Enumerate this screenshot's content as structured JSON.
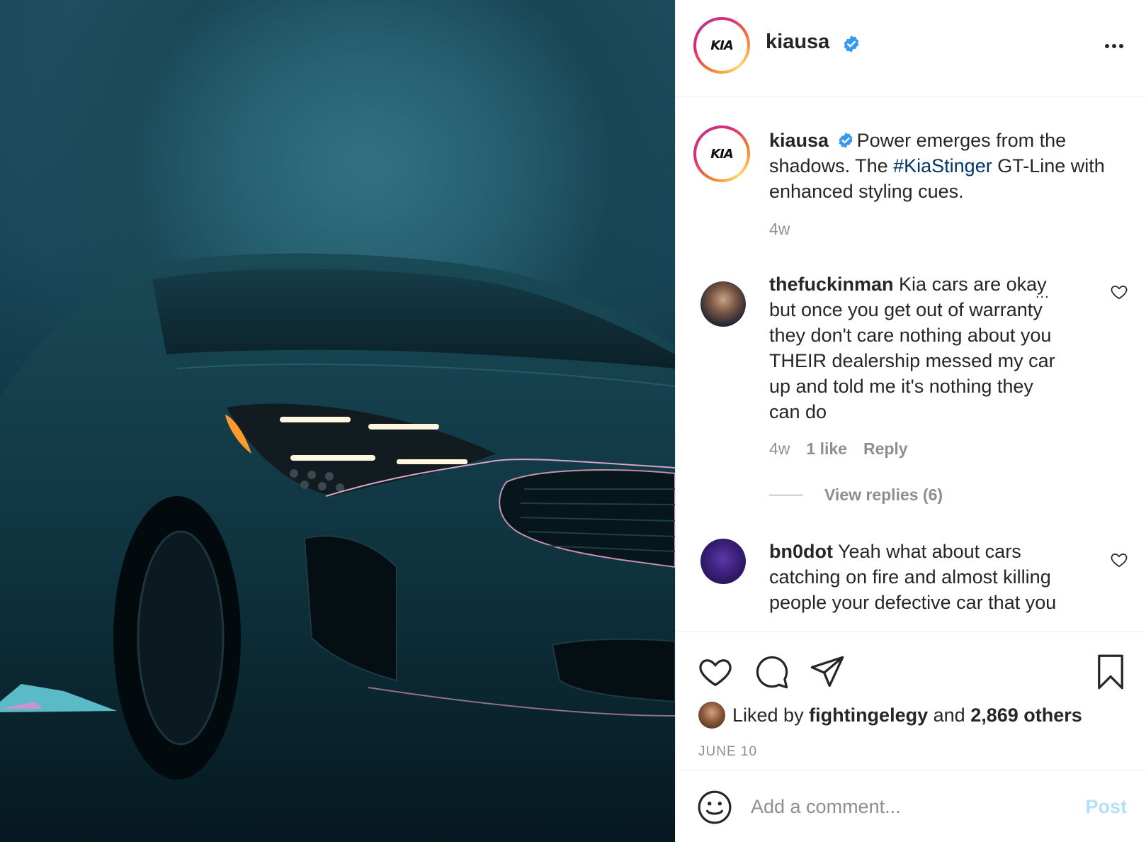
{
  "post": {
    "username": "kiausa",
    "logo_text": "KIA",
    "verified": true
  },
  "caption": {
    "username": "kiausa",
    "text_before": "Power emerges from the shadows. The ",
    "hashtag": "#KiaStinger",
    "text_after": " GT-Line with enhanced styling cues.",
    "time": "4w"
  },
  "comments": [
    {
      "username": "thefuckinman",
      "text_lines": [
        "Kia cars are okay",
        "but once you get out of warranty",
        "they don't care nothing about you",
        "THEIR dealership messed my car",
        "up and told me it's nothing they",
        "can do"
      ],
      "time": "4w",
      "likes": "1 like",
      "reply_label": "Reply",
      "view_replies": "View replies (6)",
      "more_label": "..."
    },
    {
      "username": "bn0dot",
      "text_lines": [
        "Yeah what about cars",
        "catching on fire and almost killing",
        "people your defective car that you"
      ]
    }
  ],
  "actions": {
    "like_icon": "heart-icon",
    "comment_icon": "comment-bubble-icon",
    "share_icon": "paper-plane-icon",
    "save_icon": "bookmark-icon"
  },
  "likes": {
    "prefix": "Liked by",
    "user": "fightingelegy",
    "middle": "and",
    "others": "2,869 others"
  },
  "date": "JUNE 10",
  "add_comment": {
    "placeholder": "Add a comment...",
    "post_label": "Post",
    "emoji_icon": "smiley-icon"
  },
  "colors": {
    "verified_blue": "#3897f0",
    "hashtag": "#00376b",
    "muted_text": "#8e8e8e",
    "post_disabled": "#b2dffc"
  }
}
